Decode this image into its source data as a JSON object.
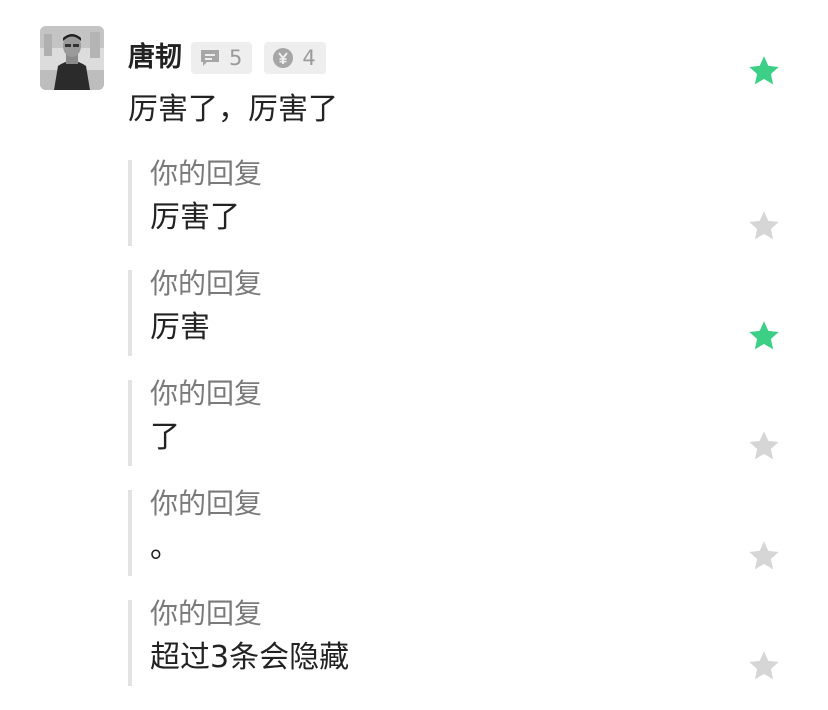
{
  "comment": {
    "author": "唐韧",
    "reply_count": "5",
    "reward_count": "4",
    "text": "厉害了，厉害了",
    "starred": true,
    "reply_icon": "comment-bubble-icon",
    "reward_icon": "reward-coin-icon"
  },
  "replies": [
    {
      "label": "你的回复",
      "text": "厉害了",
      "starred": false
    },
    {
      "label": "你的回复",
      "text": "厉害",
      "starred": true
    },
    {
      "label": "你的回复",
      "text": "了",
      "starred": false
    },
    {
      "label": "你的回复",
      "text": "。",
      "starred": false
    },
    {
      "label": "你的回复",
      "text": "超过3条会隐藏",
      "starred": false
    }
  ],
  "colors": {
    "star_active": "#3ccf86",
    "star_inactive": "#d6d6d6",
    "reply_border": "#e3e3e3"
  }
}
